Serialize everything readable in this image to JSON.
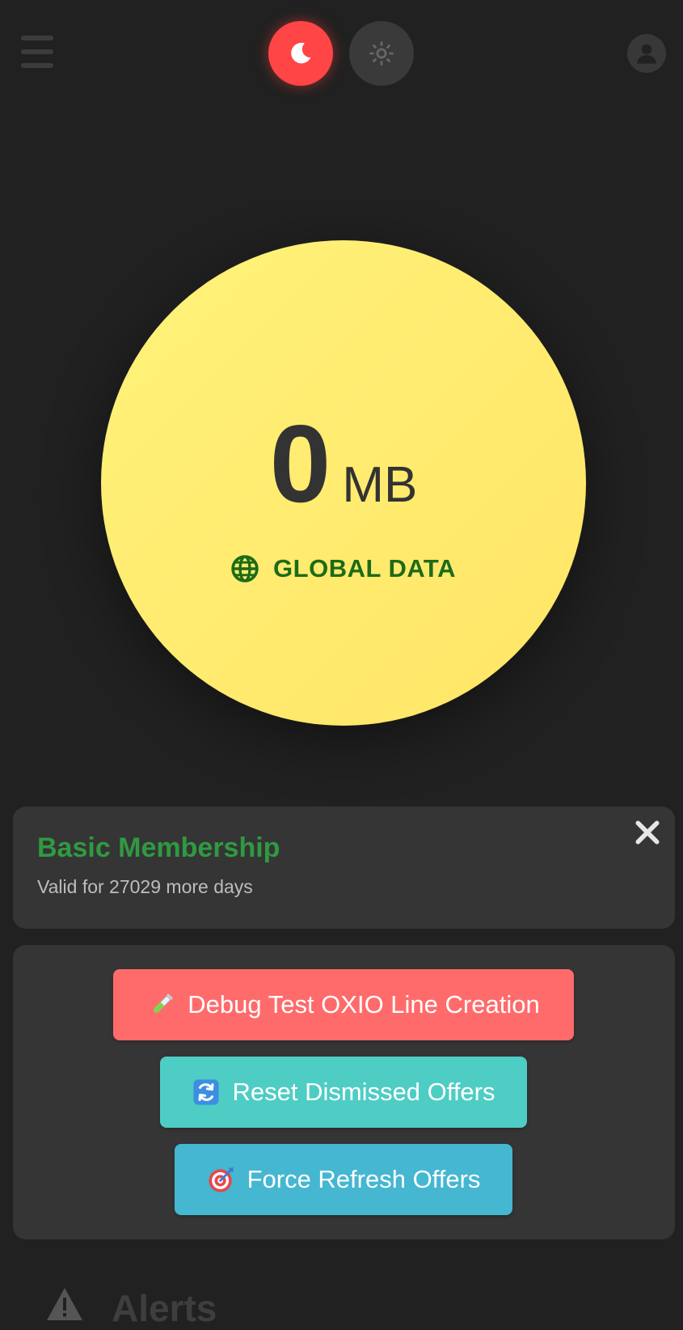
{
  "header": {
    "menu_icon": "hamburger-menu-icon",
    "dark_mode_icon": "moon-icon",
    "light_mode_icon": "sun-icon",
    "profile_icon": "user-avatar-icon",
    "active_theme": "dark",
    "colors": {
      "active_theme": "#ff4545",
      "inactive_theme": "#3a3a3a",
      "icons": "#3c3c3c"
    }
  },
  "data_usage": {
    "value": "0",
    "unit": "MB",
    "label": "GLOBAL DATA",
    "label_icon": "globe-icon",
    "colors": {
      "circle": "#ffec70",
      "value_text": "#333333",
      "label_text": "#1d6b17"
    }
  },
  "membership": {
    "title": "Basic Membership",
    "subtitle": "Valid for 27029 more days",
    "close_icon": "close-icon",
    "colors": {
      "title": "#2f9a41"
    }
  },
  "debug_actions": [
    {
      "label": "Debug Test OXIO Line Creation",
      "icon": "test-tube-icon",
      "color": "#ff6b6b"
    },
    {
      "label": "Reset Dismissed Offers",
      "icon": "refresh-arrows-icon",
      "color": "#4ecdc4"
    },
    {
      "label": "Force Refresh Offers",
      "icon": "target-icon",
      "color": "#45b7d1"
    }
  ],
  "alerts": {
    "title": "Alerts",
    "icon": "warning-icon"
  }
}
